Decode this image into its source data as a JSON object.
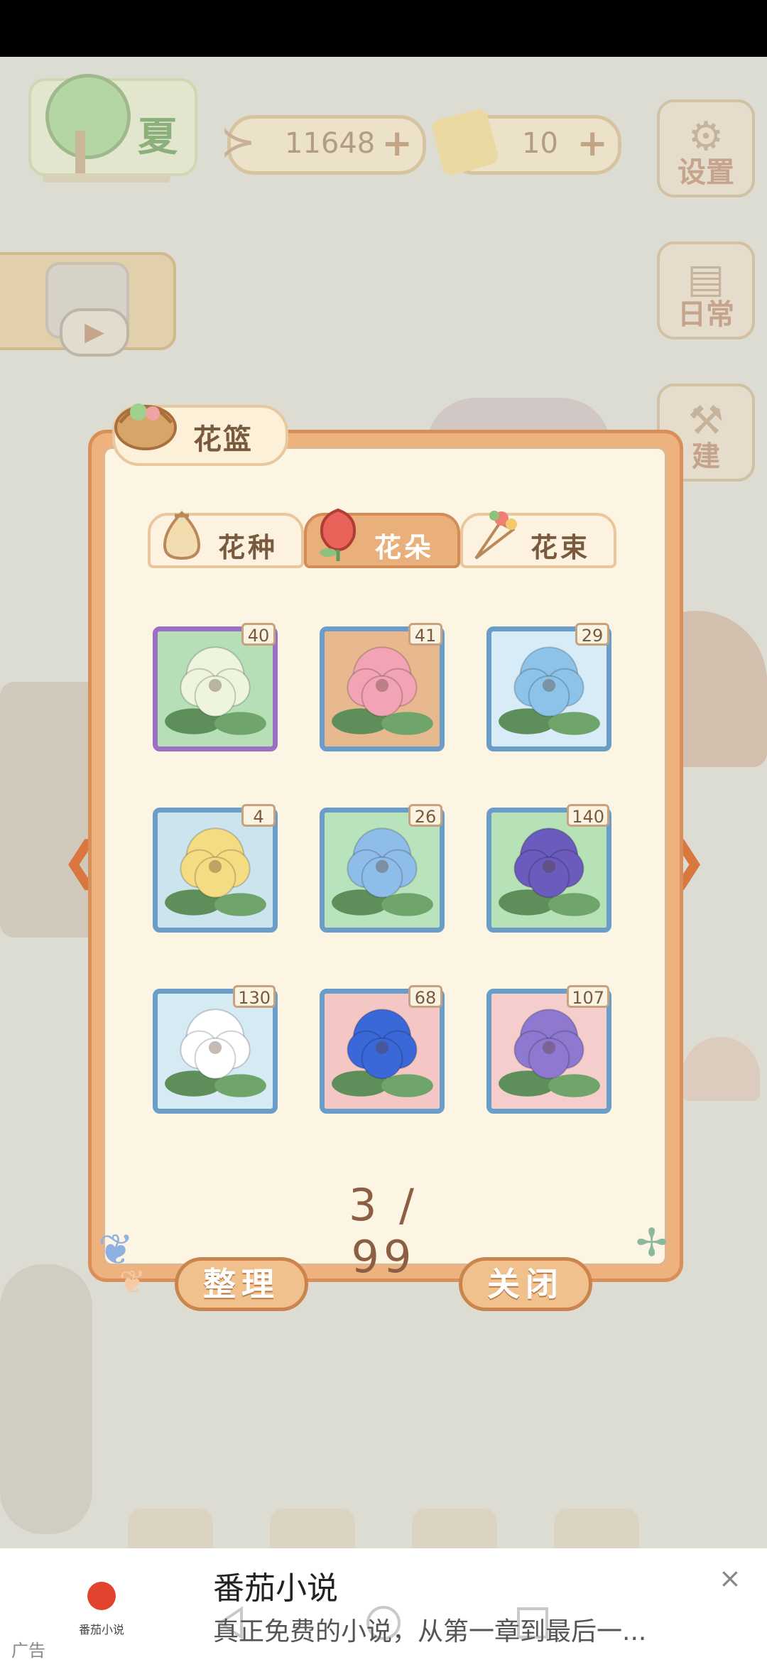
{
  "hud": {
    "season_label": "夏",
    "fish_count": "11648",
    "cheese_count": "10",
    "settings_label": "设置",
    "daily_label": "日常",
    "build_label": "建"
  },
  "dialog": {
    "title": "花篮",
    "tabs": [
      {
        "label": "花种",
        "active": false
      },
      {
        "label": "花朵",
        "active": true
      },
      {
        "label": "花束",
        "active": false
      }
    ],
    "items": [
      {
        "name": "white-peony",
        "count": "40",
        "bg": "#b6dfb8",
        "petal": "#eef5df",
        "frame": "purple"
      },
      {
        "name": "pink-peony",
        "count": "41",
        "bg": "#e8b98f",
        "petal": "#f2a3b4",
        "frame": "blue"
      },
      {
        "name": "blue-bud",
        "count": "29",
        "bg": "#d7ecf7",
        "petal": "#8dc3e8",
        "frame": "blue"
      },
      {
        "name": "yellow-flower",
        "count": "4",
        "bg": "#cce4ee",
        "petal": "#f4dc83",
        "frame": "blue"
      },
      {
        "name": "morning-glory",
        "count": "26",
        "bg": "#b9e3bc",
        "petal": "#8fbde9",
        "frame": "blue"
      },
      {
        "name": "hyacinth",
        "count": "140",
        "bg": "#b7e2b7",
        "petal": "#6b5bbd",
        "frame": "blue"
      },
      {
        "name": "white-narcissus",
        "count": "130",
        "bg": "#d6eaf4",
        "petal": "#ffffff",
        "frame": "blue"
      },
      {
        "name": "blue-peony",
        "count": "68",
        "bg": "#f4c6c4",
        "petal": "#3b68d8",
        "frame": "blue"
      },
      {
        "name": "iris",
        "count": "107",
        "bg": "#f6cdcd",
        "petal": "#8f78cf",
        "frame": "blue"
      }
    ],
    "page": "3 / 99",
    "sort_label": "整理",
    "close_label": "关闭"
  },
  "ad": {
    "app_name_caption": "番茄小说",
    "title": "番茄小说",
    "subtitle": "真正免费的小说，从第一章到最后一...",
    "tag": "广告",
    "close_icon": "×"
  },
  "colors": {
    "accent": "#eab07b",
    "frame_blue": "#6a9ec9",
    "frame_purple": "#9a6fc4",
    "arrow": "#d9773f"
  }
}
